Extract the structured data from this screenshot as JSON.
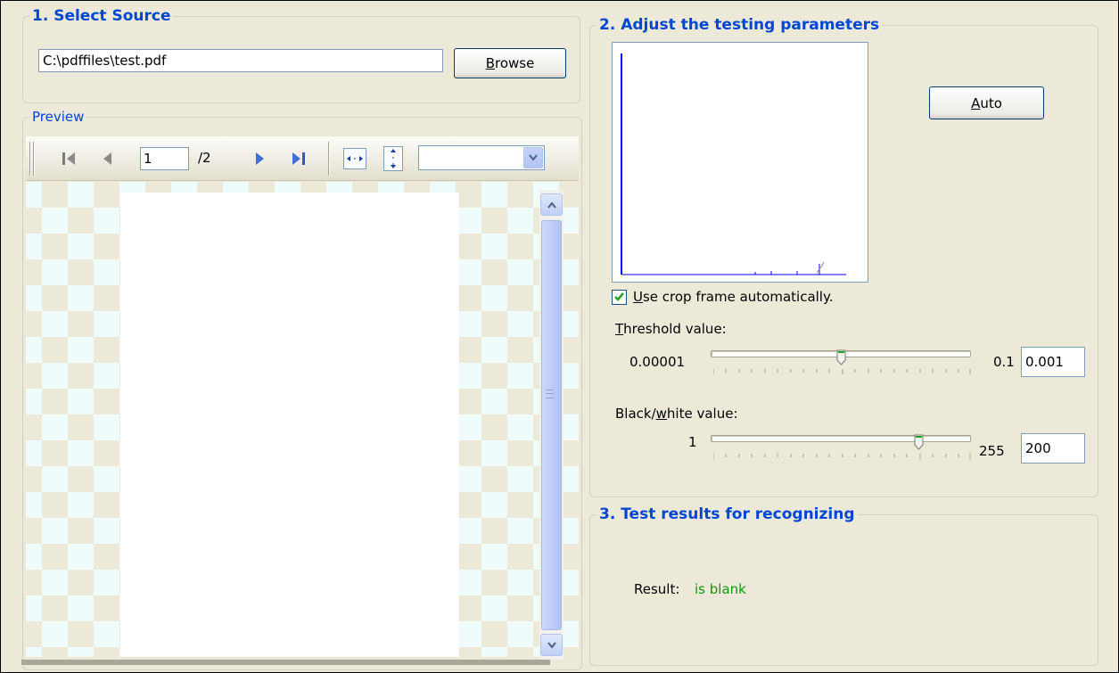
{
  "source": {
    "title": "1. Select Source",
    "path_value": "C:\\pdffiles\\test.pdf",
    "browse_label": "Browse",
    "browse_key": "B",
    "browse_rest": "rowse"
  },
  "preview": {
    "title": "Preview",
    "current_page": "1",
    "total_pages": "/2",
    "zoom_value": ""
  },
  "params": {
    "title": "2. Adjust the testing parameters",
    "auto_key": "A",
    "auto_rest": "uto",
    "crop_checked": true,
    "crop_key": "U",
    "crop_rest": "se crop frame automatically.",
    "threshold_key": "T",
    "threshold_rest": "hreshold value:",
    "threshold_min": "0.00001",
    "threshold_max": "0.1",
    "threshold_value": "0.001",
    "bw_pre": "Black/",
    "bw_key": "w",
    "bw_rest": "hite value:",
    "bw_min": "1",
    "bw_max": "255",
    "bw_value": "200"
  },
  "results": {
    "title": "3. Test results for recognizing",
    "label": "Result:",
    "value": "is blank",
    "value_color": "#119711"
  },
  "colors": {
    "legend": "#0046d5",
    "histogram_line": "#0000ff",
    "toolbar_icon": "#2b59c8"
  },
  "icons": {
    "first": "first-page-icon",
    "prev": "previous-page-icon",
    "next": "next-page-icon",
    "last": "last-page-icon",
    "fit_width": "fit-width-icon",
    "fit_height": "fit-height-icon"
  }
}
